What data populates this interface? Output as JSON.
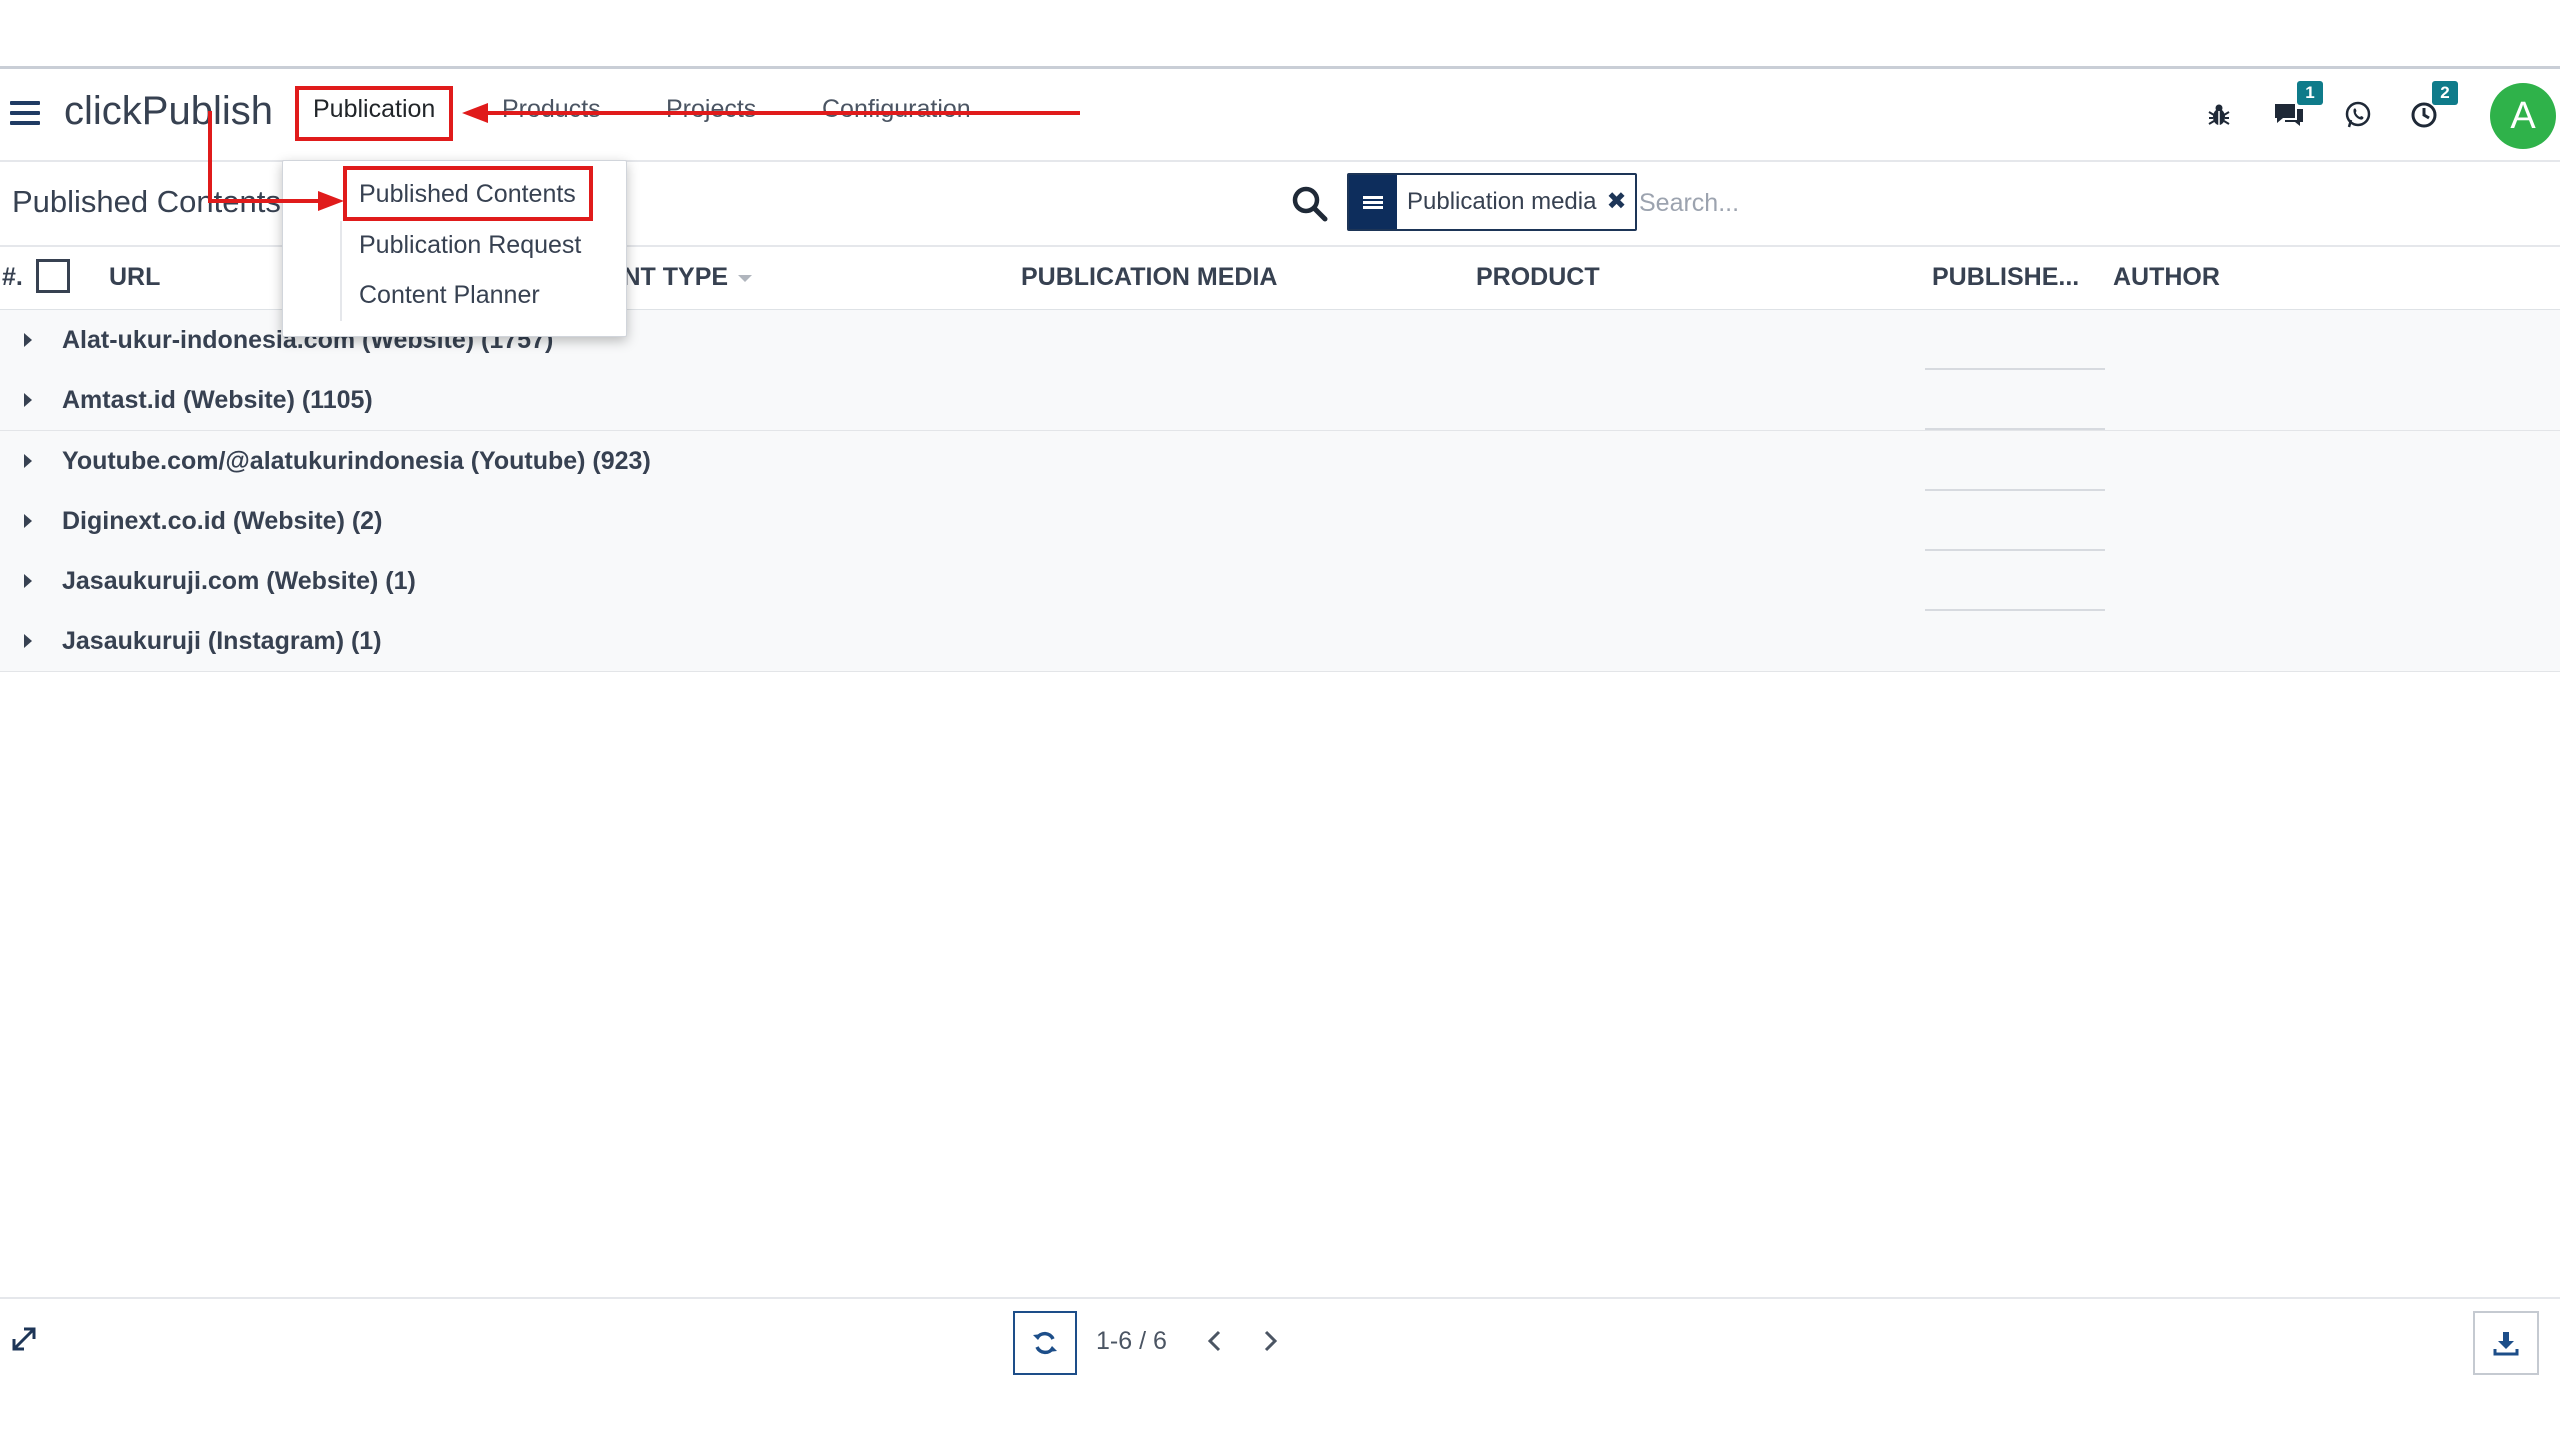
{
  "app": {
    "brand": "clickPublish"
  },
  "nav": {
    "menus": [
      "Publication",
      "Products",
      "Projects",
      "Configuration"
    ],
    "badges": {
      "messages": "1",
      "activities": "2"
    },
    "avatar_initial": "A"
  },
  "control_panel": {
    "title": "Published Contents",
    "facet_label": "Publication media",
    "search_placeholder": "Search..."
  },
  "table": {
    "headers": {
      "index": "#.",
      "url": "URL",
      "content_type": "CONTENT TYPE",
      "publication_media": "PUBLICATION MEDIA",
      "product": "PRODUCT",
      "published": "PUBLISHE...",
      "author": "AUTHOR"
    },
    "groups": [
      "Alat-ukur-indonesia.com (Website) (1757)",
      "Amtast.id (Website) (1105)",
      "Youtube.com/@alatukurindonesia (Youtube) (923)",
      "Diginext.co.id (Website) (2)",
      "Jasaukuruji.com (Website) (1)",
      "Jasaukuruji (Instagram) (1)"
    ]
  },
  "dropdown": {
    "items": [
      "Published Contents",
      "Publication Request",
      "Content Planner"
    ]
  },
  "pager": {
    "value": "1-6 / 6"
  },
  "colors": {
    "accent": "#0d2d5c",
    "annotation": "#e01b1b",
    "avatar": "#2fb24a",
    "badge": "#0f7b8a"
  }
}
